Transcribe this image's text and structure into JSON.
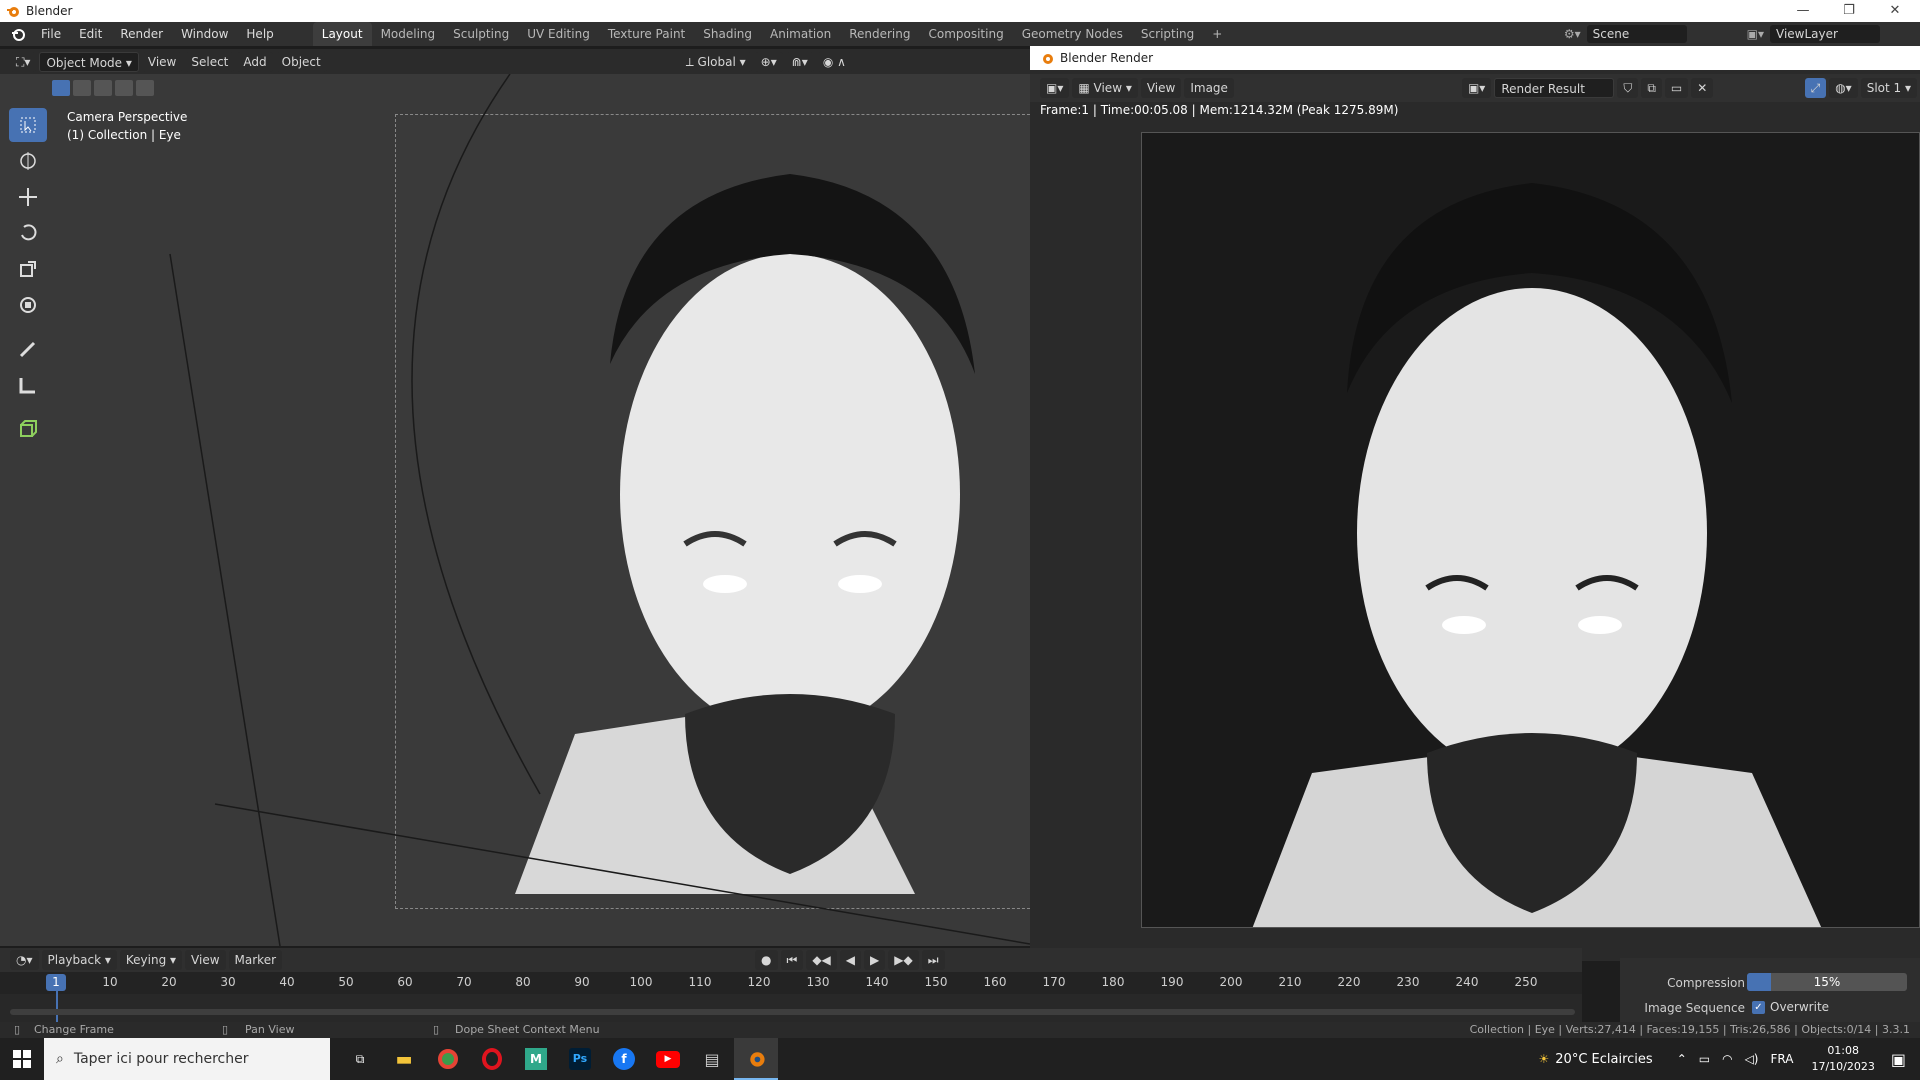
{
  "app": {
    "title": "Blender"
  },
  "menu": [
    "File",
    "Edit",
    "Render",
    "Window",
    "Help"
  ],
  "workspaces": [
    "Layout",
    "Modeling",
    "Sculpting",
    "UV Editing",
    "Texture Paint",
    "Shading",
    "Animation",
    "Rendering",
    "Compositing",
    "Geometry Nodes",
    "Scripting"
  ],
  "active_workspace": "Layout",
  "scene": {
    "label": "Scene",
    "view_layer": "ViewLayer"
  },
  "viewport": {
    "mode": "Object Mode",
    "menus": [
      "View",
      "Select",
      "Add",
      "Object"
    ],
    "transform": "Global",
    "overlay_title": "Camera Perspective",
    "overlay_sub": "(1) Collection | Eye"
  },
  "render_window": {
    "title": "Blender Render",
    "menus": [
      "View",
      "View",
      "Image"
    ],
    "result": "Render Result",
    "slot": "Slot 1",
    "info": "Frame:1 | Time:00:05.08 | Mem:1214.32M (Peak 1275.89M)"
  },
  "timeline": {
    "menus": [
      "Playback",
      "Keying",
      "View",
      "Marker"
    ],
    "current_frame": "1",
    "ticks": [
      "10",
      "20",
      "30",
      "40",
      "50",
      "60",
      "70",
      "80",
      "90",
      "100",
      "110",
      "120",
      "130",
      "140",
      "150",
      "160",
      "170",
      "180",
      "190",
      "200",
      "210",
      "220",
      "230",
      "240",
      "250"
    ]
  },
  "props": {
    "compression_label": "Compression",
    "compression_value": "15%",
    "compression_fill": 0.15,
    "image_sequence_label": "Image Sequence",
    "overwrite_label": "Overwrite"
  },
  "status": {
    "left1": "Change Frame",
    "left2": "Pan View",
    "left3": "Dope Sheet Context Menu",
    "right": "Collection | Eye | Verts:27,414 | Faces:19,155 | Tris:26,586 | Objects:0/14 | 3.3.1"
  },
  "taskbar": {
    "search_placeholder": "Taper ici pour rechercher",
    "weather": "20°C  Eclaircies",
    "lang": "FRA",
    "time": "01:08",
    "date": "17/10/2023"
  }
}
